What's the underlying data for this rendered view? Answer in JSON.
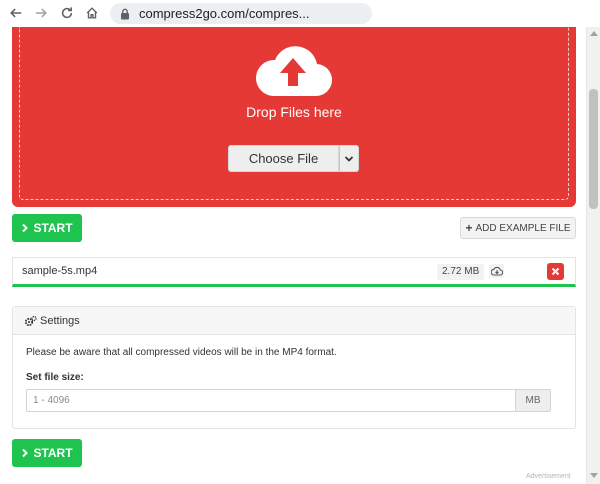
{
  "browser": {
    "url": "compress2go.com/compres..."
  },
  "dropzone": {
    "drop_text": "Drop Files here",
    "choose_label": "Choose File",
    "bg_color": "#e53935"
  },
  "actions": {
    "start_label": "START",
    "add_example_label": "ADD EXAMPLE FILE",
    "start_color": "#1fc44f"
  },
  "file": {
    "name": "sample-5s.mp4",
    "size": "2.72 MB"
  },
  "settings": {
    "title": "Settings",
    "note": "Please be aware that all compressed videos will be in the MP4 format.",
    "file_size_label": "Set file size:",
    "file_size_placeholder": "1 - 4096",
    "file_size_value": "",
    "unit": "MB"
  },
  "footer": {
    "advertisement": "Advertisement"
  },
  "icons": [
    "back-arrow-icon",
    "forward-arrow-icon",
    "reload-icon",
    "home-icon",
    "lock-icon",
    "cloud-upload-icon",
    "chevron-down-icon",
    "chevron-right-icon",
    "plus-icon",
    "cloud-download-icon",
    "close-icon",
    "cogs-icon"
  ]
}
